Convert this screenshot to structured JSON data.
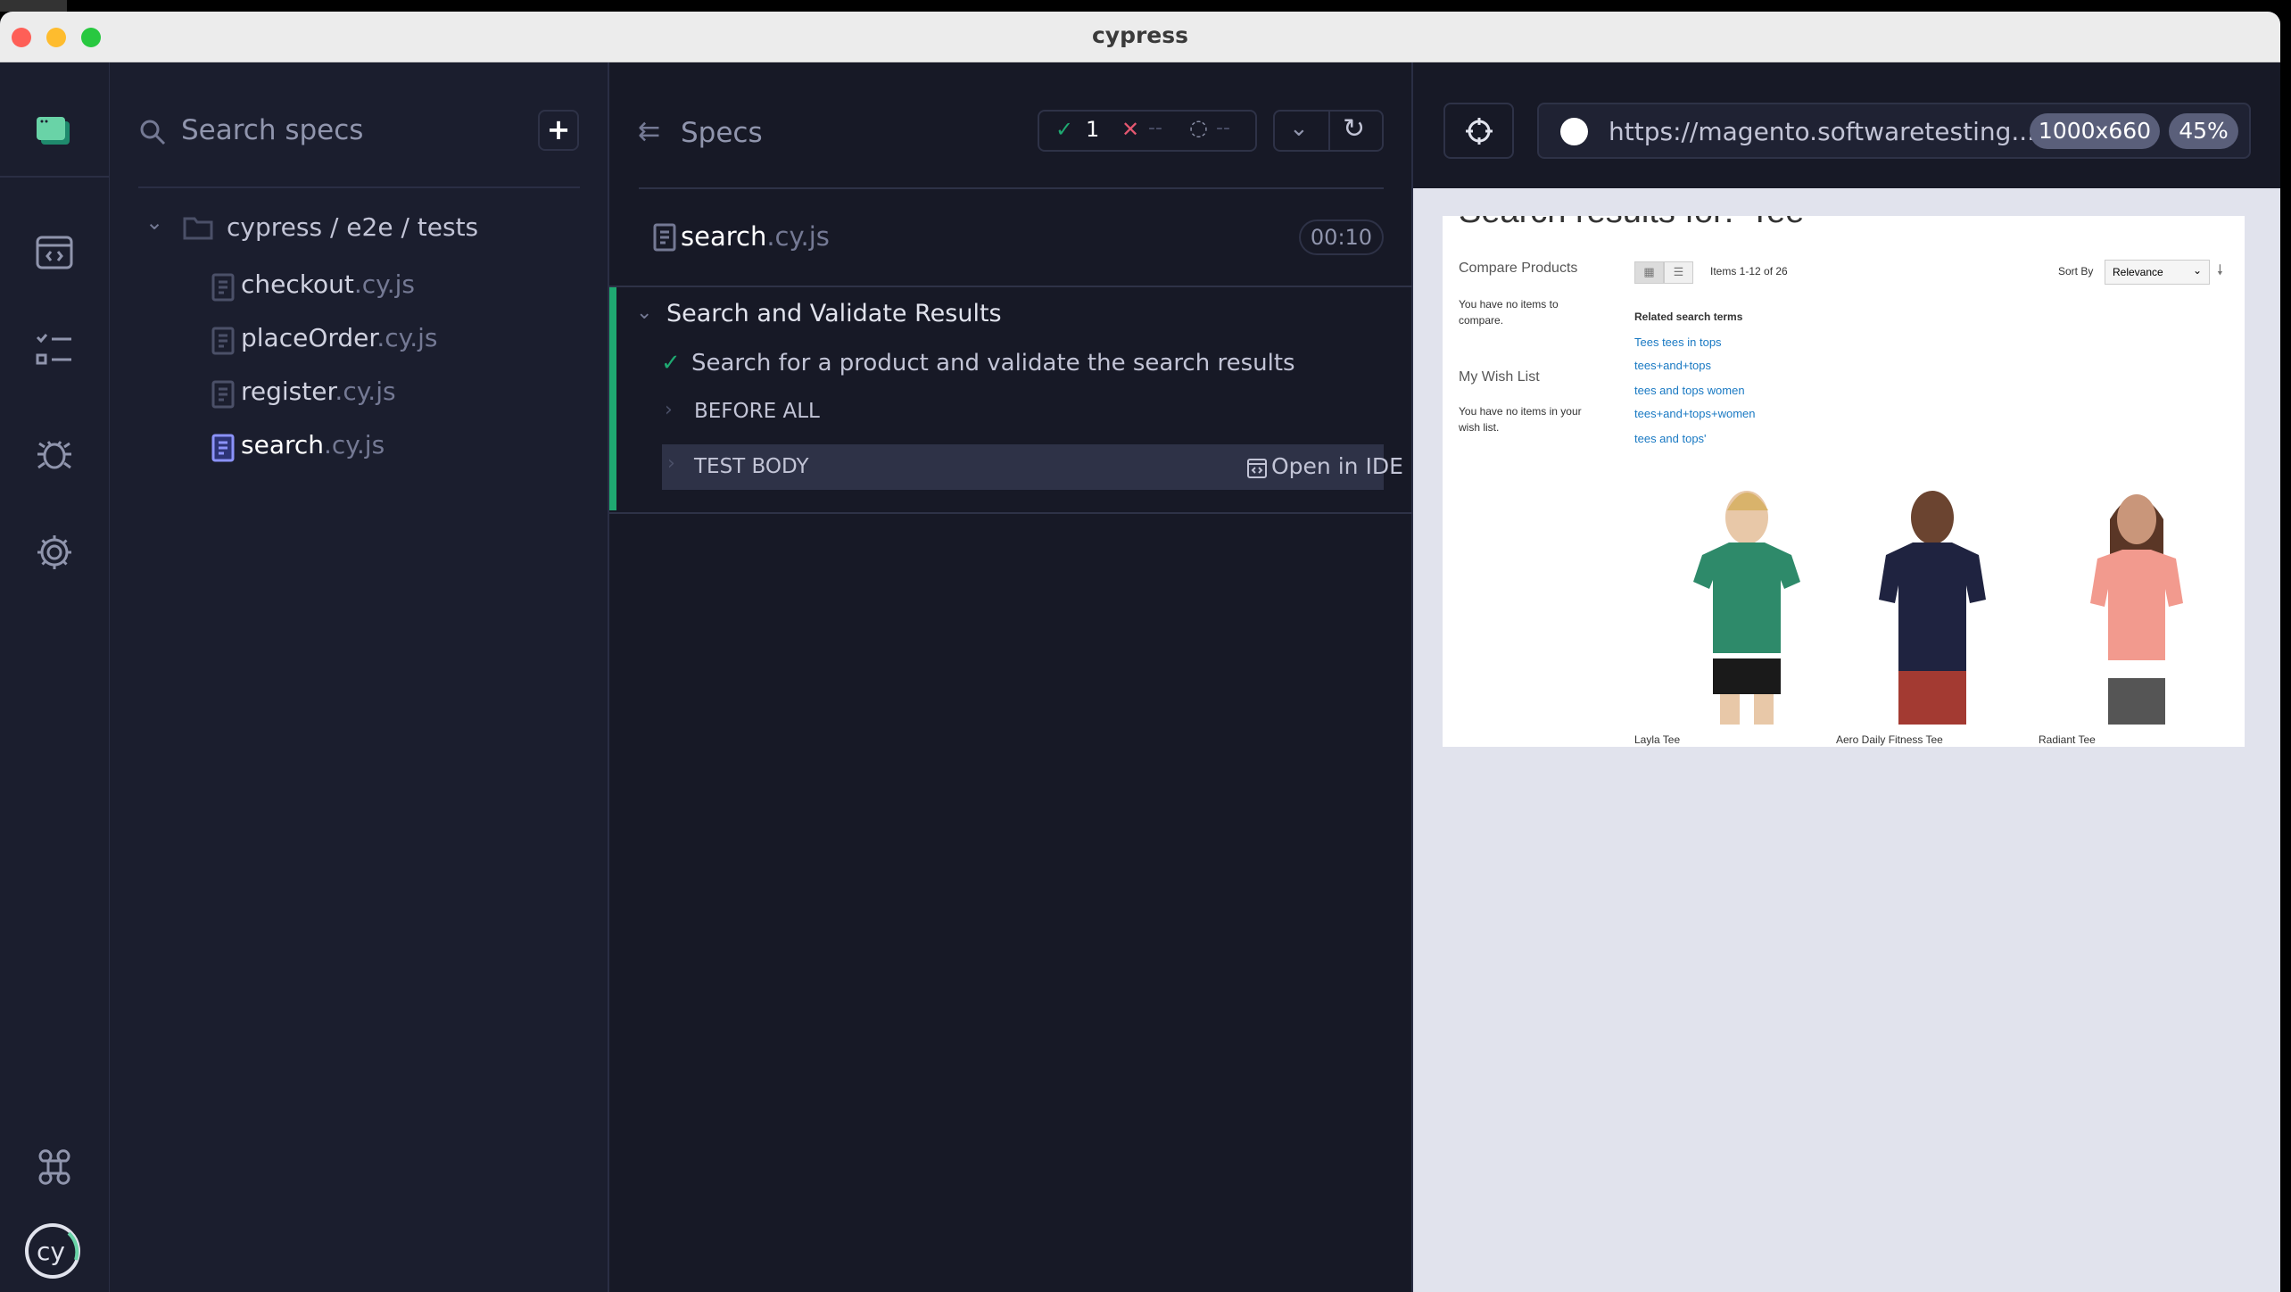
{
  "window": {
    "title": "cypress"
  },
  "nav": {
    "items": [
      "app-logo",
      "specs",
      "runs",
      "debug",
      "settings",
      "keyboard-shortcuts",
      "cypress-logo"
    ]
  },
  "specs_panel": {
    "search_placeholder": "Search specs",
    "add_label": "+",
    "folder": "cypress / e2e / tests",
    "files": [
      {
        "name": "checkout",
        "ext": ".cy.js"
      },
      {
        "name": "placeOrder",
        "ext": ".cy.js"
      },
      {
        "name": "register",
        "ext": ".cy.js"
      },
      {
        "name": "search",
        "ext": ".cy.js"
      }
    ]
  },
  "reporter": {
    "header_label": "Specs",
    "passed": "1",
    "failed": "--",
    "pending": "--",
    "spec_name": "search",
    "spec_ext": ".cy.js",
    "duration": "00:10",
    "suite": "Search and Validate Results",
    "test": "Search for a product and validate the search results",
    "hooks": [
      "BEFORE ALL",
      "TEST BODY"
    ],
    "open_ide": "Open in IDE"
  },
  "aut": {
    "url": "https://magento.softwaretesting...",
    "viewport": "1000x660",
    "scale": "45%",
    "page": {
      "heading": "Search results for: 'Tee'",
      "compare_title": "Compare Products",
      "compare_text": "You have no items to compare.",
      "wishlist_title": "My Wish List",
      "wishlist_text": "You have no items in your wish list.",
      "items_count": "Items 1-12 of 26",
      "sort_label": "Sort By",
      "sort_value": "Relevance",
      "related_title": "Related search terms",
      "related": [
        "Tees tees in tops",
        "tees+and+tops",
        "tees and tops women",
        "tees+and+tops+women",
        "tees and tops'"
      ],
      "products": [
        {
          "name": "Layla Tee",
          "color": "#2e8a6a"
        },
        {
          "name": "Aero Daily Fitness Tee",
          "color": "#1f2340"
        },
        {
          "name": "Radiant Tee",
          "color": "#f29a8e"
        }
      ]
    }
  },
  "colors": {
    "accent": "#6f77f7",
    "pass": "#1fa971",
    "fail": "#e45770",
    "link": "#1979c3"
  }
}
